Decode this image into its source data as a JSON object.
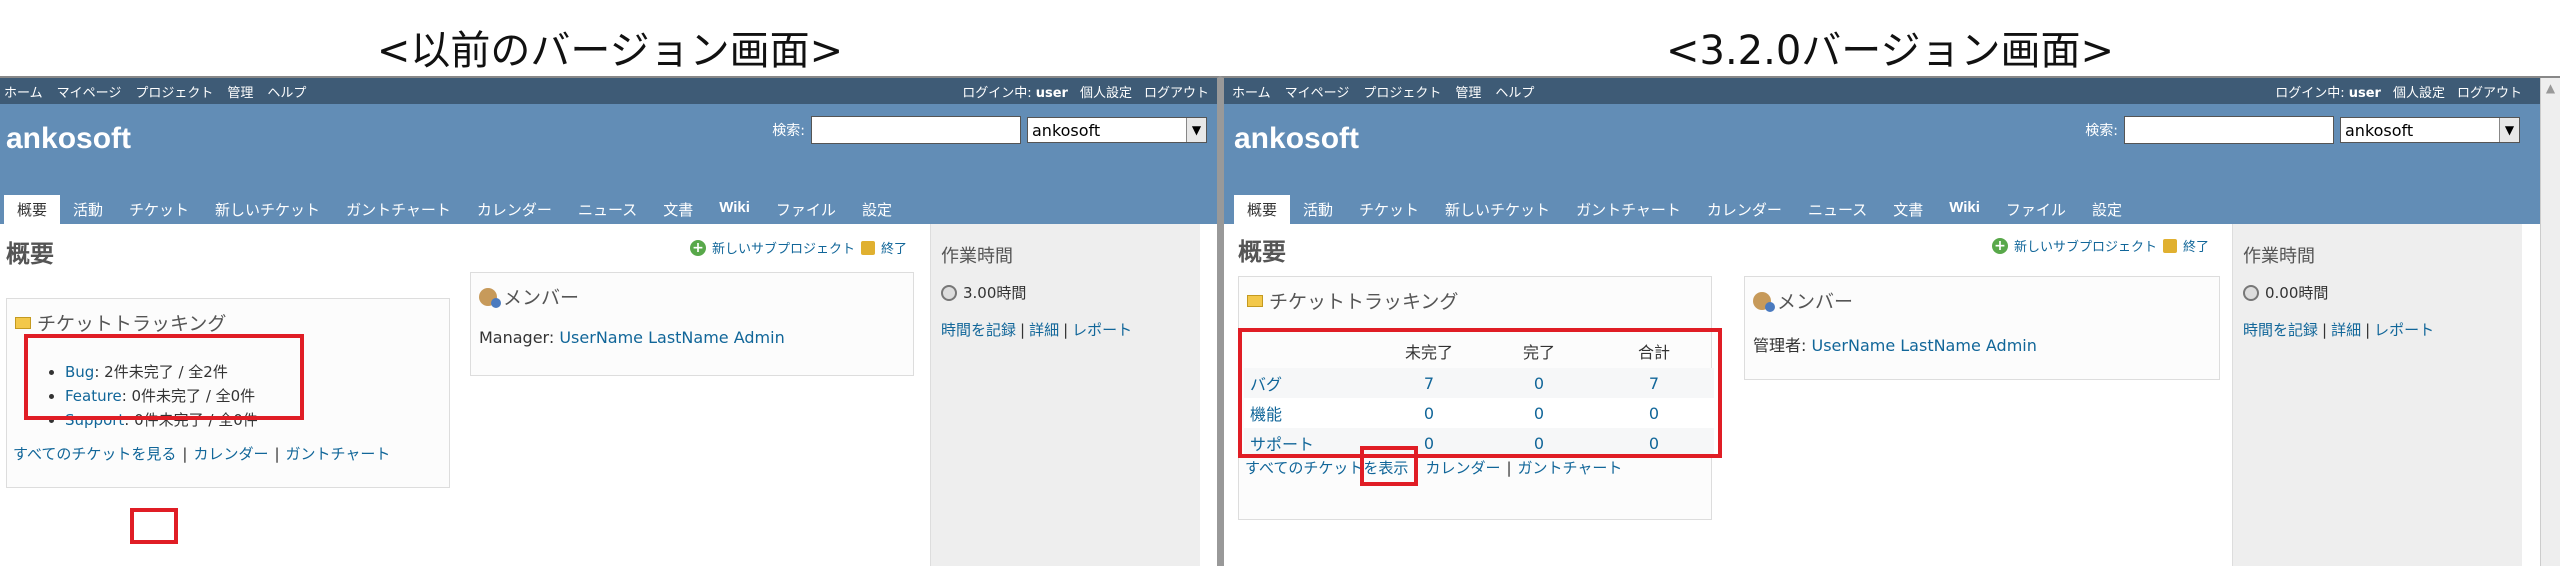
{
  "captions": {
    "left": "<以前のバージョン画面>",
    "right": "<3.2.0バージョン画面>"
  },
  "colors": {
    "top_menu": "#3e5b76",
    "header": "#628db6",
    "link": "#116699",
    "highlight": "#e01d25"
  },
  "top_menu": [
    "ホーム",
    "マイページ",
    "プロジェクト",
    "管理",
    "ヘルプ"
  ],
  "account": {
    "logged_prefix": "ログイン中:",
    "user": "user",
    "my_account": "個人設定",
    "logout": "ログアウト"
  },
  "project_title": "ankosoft",
  "search": {
    "label": "検索:",
    "value": "",
    "project_select": "ankosoft"
  },
  "tabs": [
    "概要",
    "活動",
    "チケット",
    "新しいチケット",
    "ガントチャート",
    "カレンダー",
    "ニュース",
    "文書",
    "Wiki",
    "ファイル",
    "設定"
  ],
  "page_title": "概要",
  "contextual": {
    "new_subproject": "新しいサブプロジェクト",
    "close": "終了"
  },
  "tracking": {
    "title": "チケットトラッキング"
  },
  "members": {
    "title": "メンバー"
  },
  "spent_time": {
    "title": "作業時間",
    "log_time": "時間を記録",
    "details": "詳細",
    "report": "レポート"
  },
  "old": {
    "trackers": [
      {
        "name": "Bug",
        "text": ": 2件未完了 / 全2件"
      },
      {
        "name": "Feature",
        "text": ": 0件未完了 / 全0件"
      },
      {
        "name": "Support",
        "text": ": 0件未完了 / 全0件"
      }
    ],
    "view_all_prefix": "すべてのチケットを",
    "view_all_link": "見る",
    "calendar": "カレンダー",
    "gantt": "ガントチャート",
    "member_role": "Manager:",
    "member_names": "UserName LastName Admin",
    "hours": "3.00時間"
  },
  "new": {
    "table_headers": [
      "",
      "未完了",
      "完了",
      "合計"
    ],
    "table_rows": [
      {
        "name": "バグ",
        "open": "7",
        "closed": "0",
        "total": "7"
      },
      {
        "name": "機能",
        "open": "0",
        "closed": "0",
        "total": "0"
      },
      {
        "name": "サポート",
        "open": "0",
        "closed": "0",
        "total": "0"
      }
    ],
    "view_all_prefix": "すべてのチケット",
    "view_all_link": "を表示",
    "calendar": "カレンダー",
    "gantt": "ガントチャート",
    "member_role": "管理者:",
    "member_names": "UserName LastName Admin",
    "hours": "0.00時間"
  }
}
